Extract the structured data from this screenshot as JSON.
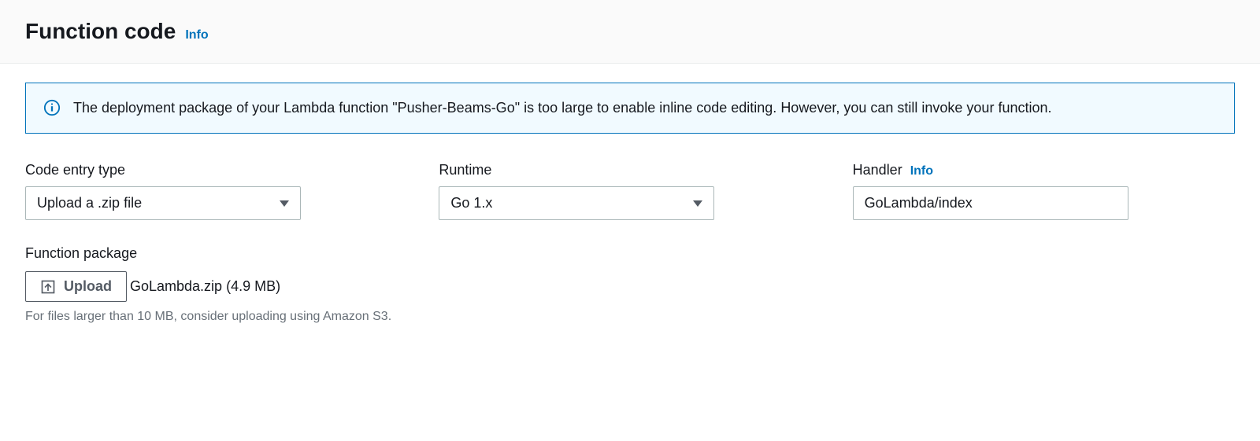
{
  "header": {
    "title": "Function code",
    "info_label": "Info"
  },
  "alert": {
    "message": "The deployment package of your Lambda function \"Pusher-Beams-Go\" is too large to enable inline code editing. However, you can still invoke your function."
  },
  "fields": {
    "code_entry": {
      "label": "Code entry type",
      "value": "Upload a .zip file"
    },
    "runtime": {
      "label": "Runtime",
      "value": "Go 1.x"
    },
    "handler": {
      "label": "Handler",
      "info_label": "Info",
      "value": "GoLambda/index"
    }
  },
  "package": {
    "label": "Function package",
    "upload_button": "Upload",
    "file_name": "GoLambda.zip (4.9 MB)",
    "helper_text": "For files larger than 10 MB, consider uploading using Amazon S3."
  }
}
